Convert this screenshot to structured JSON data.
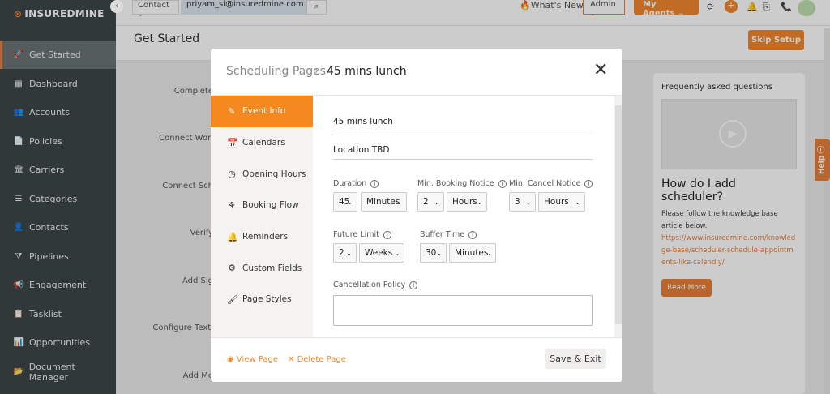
{
  "app": {
    "logo_bold": "INSUREDMINE",
    "logo_light": ""
  },
  "sidebar": {
    "items": [
      {
        "label": "Get Started",
        "icon": "🚀"
      },
      {
        "label": "Dashboard",
        "icon": "▦"
      },
      {
        "label": "Accounts",
        "icon": "👥"
      },
      {
        "label": "Policies",
        "icon": "📄"
      },
      {
        "label": "Carriers",
        "icon": "🏛"
      },
      {
        "label": "Categories",
        "icon": "☰"
      },
      {
        "label": "Contacts",
        "icon": "👤"
      },
      {
        "label": "Pipelines",
        "icon": "⧩"
      },
      {
        "label": "Engagement",
        "icon": "📢"
      },
      {
        "label": "Tasklist",
        "icon": "📋"
      },
      {
        "label": "Opportunities",
        "icon": "📊"
      },
      {
        "label": "Document Manager",
        "icon": "📂"
      }
    ]
  },
  "topbar": {
    "contact_select": "Contact",
    "search_value": "priyam_si@insuredmine.com",
    "whats_new": "What's New",
    "admin": "Admin",
    "my_agents": "My Agents"
  },
  "page": {
    "title": "Get Started",
    "skip_setup": "Skip Setup",
    "steps": [
      "Complete",
      "Connect Worl",
      "Connect Sch",
      "Verify",
      "Add Sig",
      "Configure Texti",
      "Add Me"
    ]
  },
  "faq": {
    "heading": "Frequently asked questions",
    "question": "How do I add scheduler?",
    "text": "Please follow the knowledge base article below.",
    "link": "https://www.insuredmine.com/knowledge-base/scheduler-schedule-appointments-like-calendly/",
    "read_more": "Read More",
    "help": "Help"
  },
  "modal": {
    "breadcrumb_parent": "Scheduling Pages",
    "breadcrumb_sep": "›",
    "breadcrumb_current": "45 mins lunch",
    "nav": [
      {
        "label": "Event Info",
        "icon": "✎"
      },
      {
        "label": "Calendars",
        "icon": "📅"
      },
      {
        "label": "Opening Hours",
        "icon": "◷"
      },
      {
        "label": "Booking Flow",
        "icon": "⚘"
      },
      {
        "label": "Reminders",
        "icon": "🔔"
      },
      {
        "label": "Custom Fields",
        "icon": "⚙"
      },
      {
        "label": "Page Styles",
        "icon": "🖌"
      }
    ],
    "event_name": "45 mins lunch",
    "location": "Location TBD",
    "duration": {
      "label": "Duration",
      "value": "45",
      "unit": "Minutes"
    },
    "min_booking": {
      "label": "Min. Booking Notice",
      "value": "2",
      "unit": "Hours"
    },
    "min_cancel": {
      "label": "Min. Cancel Notice",
      "value": "3",
      "unit": "Hours"
    },
    "future_limit": {
      "label": "Future Limit",
      "value": "2",
      "unit": "Weeks"
    },
    "buffer_time": {
      "label": "Buffer Time",
      "value": "30",
      "unit": "Minutes"
    },
    "cancellation_policy": {
      "label": "Cancellation Policy",
      "value": ""
    },
    "view_page": "View Page",
    "delete_page": "Delete Page",
    "save_exit": "Save & Exit"
  }
}
